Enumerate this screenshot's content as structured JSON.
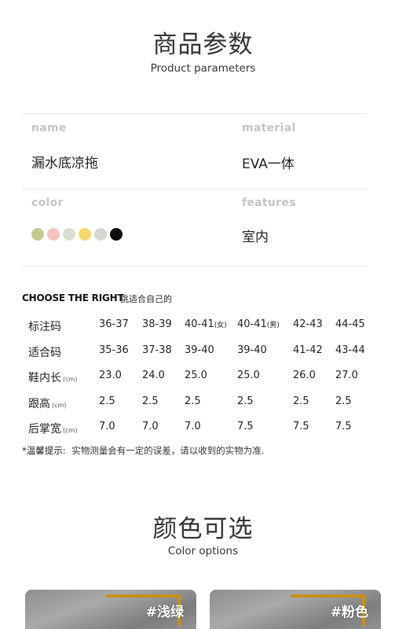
{
  "header": {
    "title_cn": "商品参数",
    "title_en": "Product parameters"
  },
  "params": {
    "name_label": "name",
    "name_value": "漏水底凉拖",
    "material_label": "material",
    "material_value": "EVA一体",
    "color_label": "color",
    "swatches": [
      "#c5c98f",
      "#f2c4bb",
      "#dcddd0",
      "#f6d76a",
      "#d6d6d1",
      "#0d0d0d"
    ],
    "features_label": "features",
    "features_value": "室内"
  },
  "choose": {
    "title": "CHOOSE THE RIGHT",
    "subtitle": "挑适合自己的"
  },
  "size_table": {
    "rows": [
      {
        "head": "标注码",
        "unit": "",
        "cells": [
          {
            "main": "36-37",
            "sub": ""
          },
          {
            "main": "38-39",
            "sub": ""
          },
          {
            "main": "40-41",
            "sub": "(女)"
          },
          {
            "main": "40-41",
            "sub": "(男)"
          },
          {
            "main": "42-43",
            "sub": ""
          },
          {
            "main": "44-45",
            "sub": ""
          }
        ]
      },
      {
        "head": "适合码",
        "unit": "",
        "cells": [
          {
            "main": "35-36",
            "sub": ""
          },
          {
            "main": "37-38",
            "sub": ""
          },
          {
            "main": "39-40",
            "sub": ""
          },
          {
            "main": "39-40",
            "sub": ""
          },
          {
            "main": "41-42",
            "sub": ""
          },
          {
            "main": "43-44",
            "sub": ""
          }
        ]
      },
      {
        "head": "鞋内长",
        "unit": "(cm)",
        "cells": [
          {
            "main": "23.0",
            "sub": ""
          },
          {
            "main": "24.0",
            "sub": ""
          },
          {
            "main": "25.0",
            "sub": ""
          },
          {
            "main": "25.0",
            "sub": ""
          },
          {
            "main": "26.0",
            "sub": ""
          },
          {
            "main": "27.0",
            "sub": ""
          }
        ]
      },
      {
        "head": "跟高",
        "unit": "(cm)",
        "cells": [
          {
            "main": "2.5",
            "sub": ""
          },
          {
            "main": "2.5",
            "sub": ""
          },
          {
            "main": "2.5",
            "sub": ""
          },
          {
            "main": "2.5",
            "sub": ""
          },
          {
            "main": "2.5",
            "sub": ""
          },
          {
            "main": "2.5",
            "sub": ""
          }
        ]
      },
      {
        "head": "后掌宽",
        "unit": "(cm)",
        "cells": [
          {
            "main": "7.0",
            "sub": ""
          },
          {
            "main": "7.0",
            "sub": ""
          },
          {
            "main": "7.0",
            "sub": ""
          },
          {
            "main": "7.5",
            "sub": ""
          },
          {
            "main": "7.5",
            "sub": ""
          },
          {
            "main": "7.5",
            "sub": ""
          }
        ]
      }
    ]
  },
  "note": {
    "key": "*温馨提示:",
    "text": "实物测量会有一定的误差，请以收到的实物为准."
  },
  "colors_section": {
    "title_cn": "颜色可选",
    "title_en": "Color options"
  },
  "color_cards": [
    {
      "tag": "#浅绿"
    },
    {
      "tag": "#粉色"
    }
  ]
}
